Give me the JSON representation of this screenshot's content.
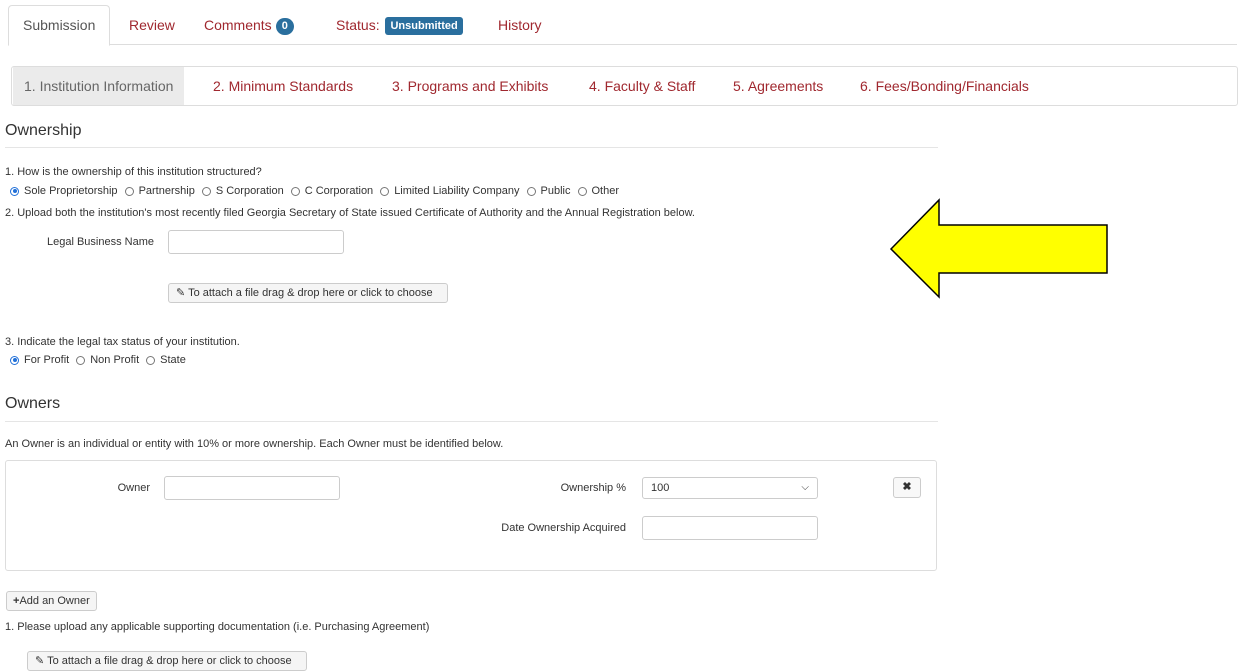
{
  "top_tabs": {
    "submission": "Submission",
    "review": "Review",
    "comments": "Comments",
    "comments_count": "0",
    "status_label": "Status:",
    "status_value": "Unsubmitted",
    "history": "History"
  },
  "steps": [
    {
      "num": "1.",
      "label": "Institution Information"
    },
    {
      "num": "2.",
      "label": "Minimum Standards"
    },
    {
      "num": "3.",
      "label": "Programs and Exhibits"
    },
    {
      "num": "4.",
      "label": "Faculty & Staff"
    },
    {
      "num": "5.",
      "label": "Agreements"
    },
    {
      "num": "6.",
      "label": "Fees/Bonding/Financials"
    }
  ],
  "ownership": {
    "heading": "Ownership",
    "q1": "1. How is the ownership of this institution structured?",
    "q1_options": [
      "Sole Proprietorship",
      "Partnership",
      "S Corporation",
      "C Corporation",
      "Limited Liability Company",
      "Public",
      "Other"
    ],
    "q2": "2. Upload both the institution's most recently filed Georgia Secretary of State issued Certificate of Authority and the Annual Registration below.",
    "legal_name_label": "Legal Business Name",
    "legal_name_value": "",
    "file_button": "To attach a file drag & drop here or click to choose",
    "q3": "3. Indicate the legal tax status of your institution.",
    "q3_options": [
      "For Profit",
      "Non Profit",
      "State"
    ]
  },
  "owners": {
    "heading": "Owners",
    "description": "An Owner is an individual or entity with 10% or more ownership. Each Owner must be identified below.",
    "owner_label": "Owner",
    "owner_value": "",
    "ownership_pct_label": "Ownership %",
    "ownership_pct_value": "100",
    "date_label": "Date Ownership Acquired",
    "date_value": "",
    "remove_button": "✖",
    "add_owner_button": "Add an Owner",
    "supporting_docs": "1. Please upload any applicable supporting documentation (i.e. Purchasing Agreement)",
    "file_button": "To attach a file drag & drop here or click to choose"
  },
  "colors": {
    "link": "#a0282f",
    "badge": "#2a6f9e",
    "arrow_fill": "#ffff00"
  },
  "icons": {
    "paperclip": "paperclip-icon",
    "plus": "plus-icon",
    "remove": "times-icon",
    "arrow": "left-arrow-icon"
  }
}
